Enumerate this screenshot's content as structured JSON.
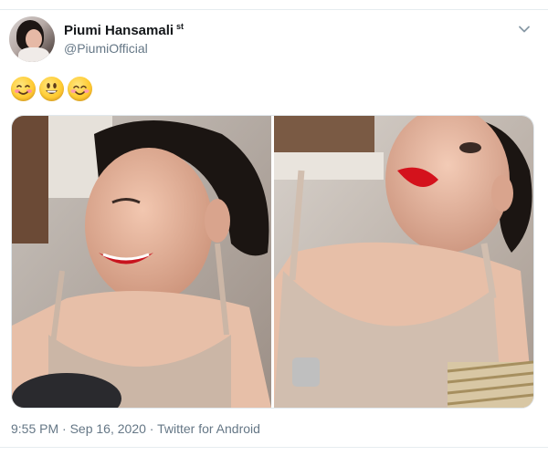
{
  "tweet": {
    "author": {
      "display_name": "Piumi Hansamali",
      "name_suffix": "st",
      "handle": "@PiumiOfficial",
      "avatar_icon": "profile-photo"
    },
    "menu_icon": "chevron-down-icon",
    "text_emojis": [
      "smiling-face-blushing",
      "grinning-face",
      "smiling-face-with-smiling-eyes"
    ],
    "media": {
      "count": 2,
      "items": [
        {
          "name": "photo-1",
          "description_icon": "photo"
        },
        {
          "name": "photo-2",
          "description_icon": "photo"
        }
      ]
    },
    "meta": {
      "time": "9:55 PM",
      "separator": "·",
      "date": "Sep 16, 2020",
      "source": "Twitter for Android"
    }
  },
  "colors": {
    "name": "#14171a",
    "secondary_text": "#657786",
    "border": "#e1e8ed"
  }
}
